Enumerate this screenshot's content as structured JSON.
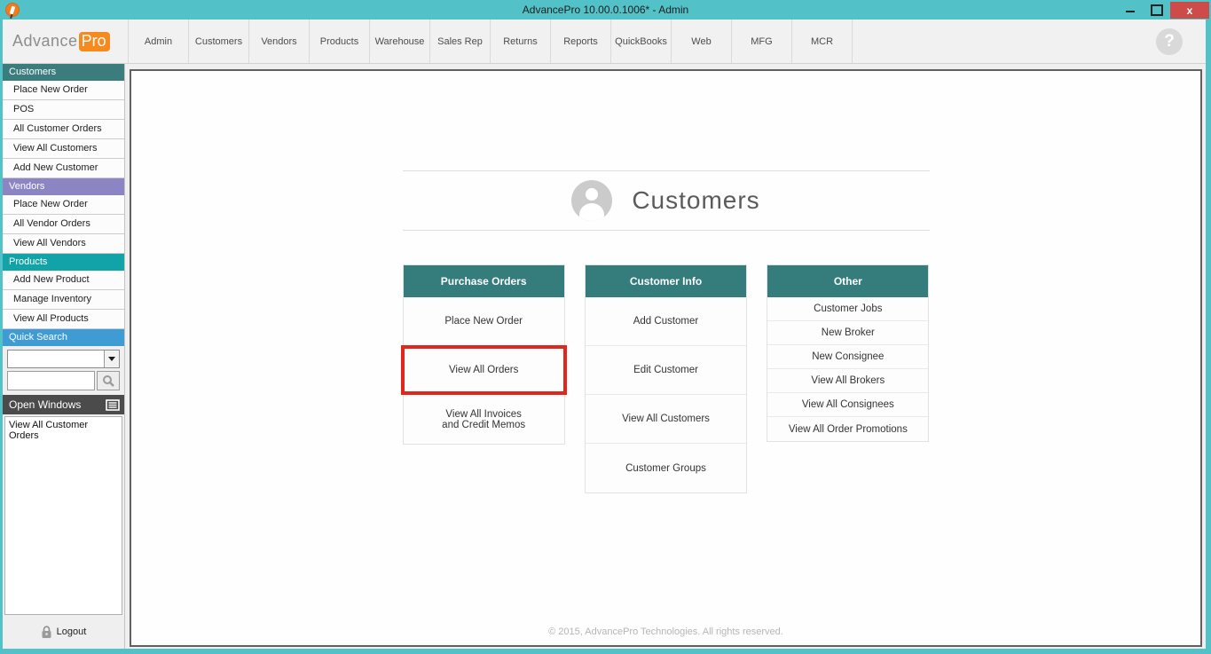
{
  "window": {
    "title": "AdvancePro 10.00.0.1006*  - Admin",
    "controls": {
      "close_label": "x"
    }
  },
  "brand": {
    "name_left": "Advance",
    "name_right": "Pro"
  },
  "nav": {
    "tabs": [
      "Admin",
      "Customers",
      "Vendors",
      "Products",
      "Warehouse",
      "Sales Rep",
      "Returns",
      "Reports",
      "QuickBooks",
      "Web",
      "MFG",
      "MCR"
    ],
    "help_label": "?"
  },
  "sidebar": {
    "sections": [
      {
        "title": "Customers",
        "color": "#3a7d7c",
        "items": [
          "Place New Order",
          "POS",
          "All Customer Orders",
          "View All Customers",
          "Add New Customer"
        ]
      },
      {
        "title": "Vendors",
        "color": "#8b85c3",
        "items": [
          "Place New Order",
          "All Vendor Orders",
          "View All Vendors"
        ]
      },
      {
        "title": "Products",
        "color": "#12a3a9",
        "items": [
          "Add New Product",
          "Manage Inventory",
          "View All Products"
        ]
      }
    ],
    "quick_search": {
      "title": "Quick Search",
      "color": "#3f9bd3",
      "dropdown_value": "",
      "search_value": ""
    },
    "open_windows": {
      "title": "Open Windows",
      "color": "#4b4b4b",
      "items": [
        "View All Customer Orders"
      ]
    },
    "logout_label": "Logout"
  },
  "main": {
    "page_title": "Customers",
    "cards": [
      {
        "title": "Purchase Orders",
        "compact": false,
        "items": [
          {
            "label": "Place New Order",
            "highlighted": false
          },
          {
            "label": "View All Orders",
            "highlighted": true
          },
          {
            "label": "View All Invoices\nand Credit Memos",
            "highlighted": false
          }
        ]
      },
      {
        "title": "Customer Info",
        "compact": false,
        "items": [
          {
            "label": "Add Customer",
            "highlighted": false
          },
          {
            "label": "Edit Customer",
            "highlighted": false
          },
          {
            "label": "View All Customers",
            "highlighted": false
          },
          {
            "label": "Customer Groups",
            "highlighted": false
          }
        ]
      },
      {
        "title": "Other",
        "compact": true,
        "items": [
          {
            "label": "Customer Jobs",
            "highlighted": false
          },
          {
            "label": "New Broker",
            "highlighted": false
          },
          {
            "label": "New Consignee",
            "highlighted": false
          },
          {
            "label": "View All Brokers",
            "highlighted": false
          },
          {
            "label": "View All Consignees",
            "highlighted": false
          },
          {
            "label": "View All Order Promotions",
            "highlighted": false
          }
        ]
      }
    ],
    "footer": "© 2015, AdvancePro Technologies. All rights reserved."
  },
  "colors": {
    "titlebar_teal": "#52c1c8",
    "close_red": "#cd4c4a",
    "logo_orange": "#f68a1e",
    "card_header_teal": "#357d7d",
    "highlight_red": "#e2261b"
  }
}
